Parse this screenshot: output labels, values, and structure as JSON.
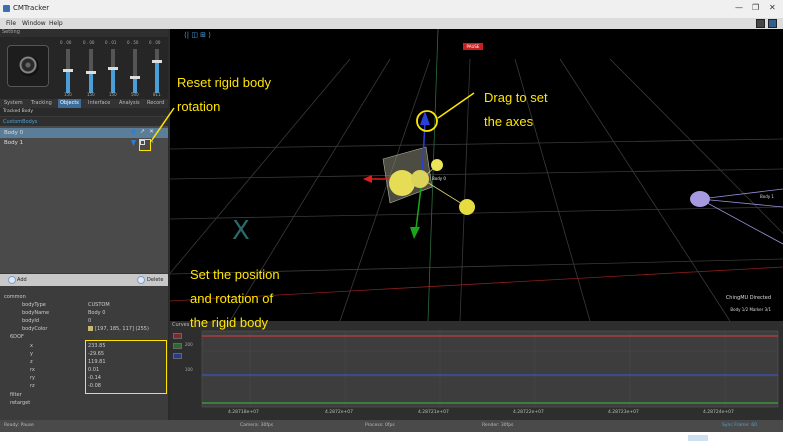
{
  "window": {
    "title": "CMTracker",
    "controls": [
      "—",
      "❐",
      "✕"
    ]
  },
  "menu": [
    "File",
    "Window",
    "Help"
  ],
  "setting_panel": {
    "header": "Setting",
    "sliders": [
      {
        "value_label": "0 . 00",
        "min_label": "150",
        "level": 0.5
      },
      {
        "value_label": "0 . 00",
        "min_label": "150",
        "level": 0.45
      },
      {
        "value_label": "0 . 01",
        "min_label": "150",
        "level": 0.55
      },
      {
        "value_label": "0 . 50",
        "min_label": "500",
        "level": 0.35
      },
      {
        "value_label": "0 . 00",
        "min_label": "811",
        "level": 0.7
      }
    ],
    "tabs": [
      "System",
      "Tracking",
      "Objects",
      "Interface",
      "Analysis",
      "Record"
    ],
    "active_tab": "Objects",
    "tracker_row": "Tracked Body",
    "rigid_bodies_header": "CustomBodys",
    "rigid_bodies": [
      "Body 0",
      "Body 1"
    ],
    "add_label": "Add",
    "delete_label": "Delete"
  },
  "properties": {
    "common_label": "common",
    "rows": [
      {
        "key": "bodyType",
        "value": "CUSTOM"
      },
      {
        "key": "bodyName",
        "value": "Body 0"
      },
      {
        "key": "bodyId",
        "value": "0"
      },
      {
        "key": "bodyColor",
        "value": "[197, 185, 117] (255)"
      }
    ],
    "sixdof_label": "6DOF",
    "sixdof": [
      {
        "key": "x",
        "value": "233.85"
      },
      {
        "key": "y",
        "value": "-29.65"
      },
      {
        "key": "z",
        "value": "119.81"
      },
      {
        "key": "rx",
        "value": "0.01"
      },
      {
        "key": "ry",
        "value": "-0.14"
      },
      {
        "key": "rz",
        "value": "-0.08"
      }
    ],
    "filter_label": "filter",
    "retarget_label": "retarget"
  },
  "viewport": {
    "pause_badge": "PAUSE",
    "toolbar_glyph": "⟨| ◫ ⊞ ⟩",
    "body_label": "Body 0",
    "peer_label": "Body 1",
    "direction_label": "ChingMU Directed",
    "status_label": "Body 1/2  Marker 3/1"
  },
  "graph": {
    "title": "Curves",
    "x_ticks": [
      "4.28718e+07",
      "4.2872e+07",
      "4.28721e+07",
      "4.28722e+07",
      "4.28723e+07",
      "4.28724e+07"
    ],
    "y_ticks": [
      "200",
      "100"
    ],
    "series_colors": {
      "x": "#e03b3b",
      "y": "#3bbf3b",
      "z": "#3a56d8"
    }
  },
  "statusbar": {
    "left": "Ready: Pause",
    "camera": "Camera: 30fps",
    "process": "Process: 0fps",
    "render": "Render: 30fps",
    "right": "Sync Frame: 60"
  },
  "annotations": {
    "reset": [
      "Reset  rigid body",
      "rotation"
    ],
    "drag": [
      "Drag to set",
      "the axes"
    ],
    "position": [
      "Set the position",
      "and  rotation of",
      "the rigid body"
    ]
  }
}
